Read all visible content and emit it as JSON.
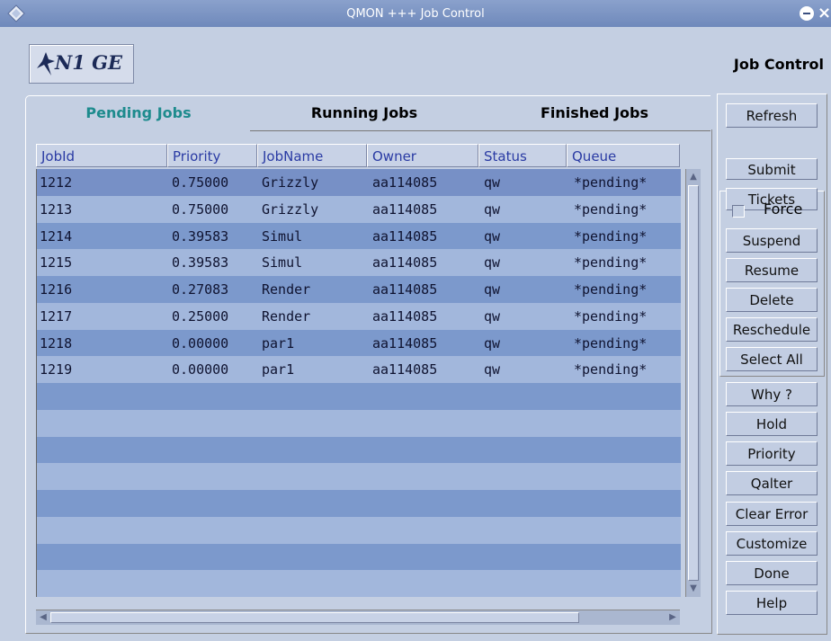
{
  "window": {
    "title": "QMON +++ Job Control",
    "icon": "diamond-icon",
    "minimize_icon": "minimize-icon",
    "close_label": "×"
  },
  "header": {
    "logo_text": "N1 GE",
    "title": "Job Control"
  },
  "tabs": [
    {
      "label": "Pending Jobs",
      "selected": true
    },
    {
      "label": "Running Jobs",
      "selected": false
    },
    {
      "label": "Finished Jobs",
      "selected": false
    }
  ],
  "table": {
    "columns": [
      "JobId",
      "Priority",
      "JobName",
      "Owner",
      "Status",
      "Queue"
    ],
    "rows": [
      [
        "1212",
        "0.75000",
        "Grizzly",
        "aa114085",
        "qw",
        "*pending*"
      ],
      [
        "1213",
        "0.75000",
        "Grizzly",
        "aa114085",
        "qw",
        "*pending*"
      ],
      [
        "1214",
        "0.39583",
        "Simul",
        "aa114085",
        "qw",
        "*pending*"
      ],
      [
        "1215",
        "0.39583",
        "Simul",
        "aa114085",
        "qw",
        "*pending*"
      ],
      [
        "1216",
        "0.27083",
        "Render",
        "aa114085",
        "qw",
        "*pending*"
      ],
      [
        "1217",
        "0.25000",
        "Render",
        "aa114085",
        "qw",
        "*pending*"
      ],
      [
        "1218",
        "0.00000",
        "par1",
        "aa114085",
        "qw",
        "*pending*"
      ],
      [
        "1219",
        "0.00000",
        "par1",
        "aa114085",
        "qw",
        "*pending*"
      ]
    ]
  },
  "buttons": {
    "refresh": "Refresh",
    "submit": "Submit",
    "tickets": "Tickets",
    "force": "Force",
    "suspend": "Suspend",
    "resume": "Resume",
    "delete": "Delete",
    "reschedule": "Reschedule",
    "select_all": "Select All",
    "why": "Why ?",
    "hold": "Hold",
    "priority": "Priority",
    "qalter": "Qalter",
    "clear_error": "Clear Error",
    "customize": "Customize",
    "done": "Done",
    "help": "Help"
  },
  "colors": {
    "window_bg": "#c4cfe2",
    "row_dark": "#7c99cc",
    "row_light": "#a2b7dc",
    "active_tab_text": "#1d8b8d",
    "header_text": "#2a3ba4"
  }
}
